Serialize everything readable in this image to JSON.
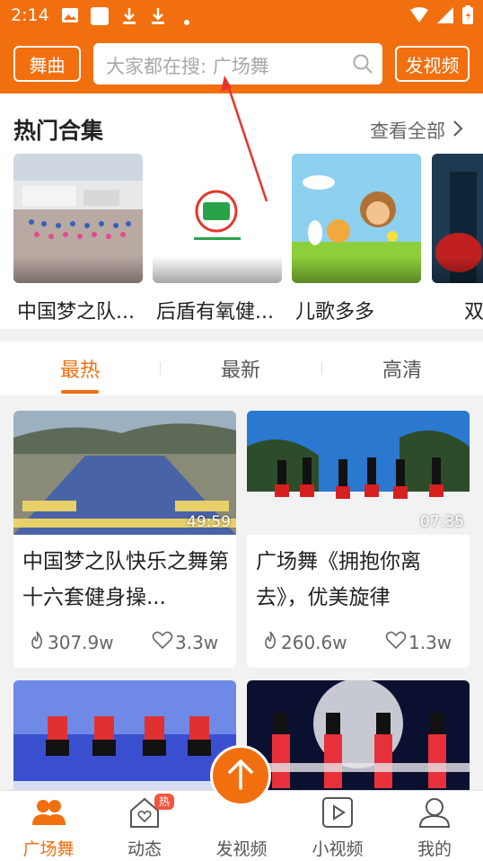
{
  "status_bar": {
    "time": "2:14"
  },
  "header": {
    "left_button": "舞曲",
    "search_placeholder": "大家都在搜: 广场舞",
    "right_button": "发视频"
  },
  "hot_collections": {
    "title": "热门合集",
    "see_all": "查看全部",
    "items": [
      {
        "label": "中国梦之队..."
      },
      {
        "label": "后盾有氧健..."
      },
      {
        "label": "儿歌多多"
      },
      {
        "label": "双"
      }
    ]
  },
  "tabs": [
    {
      "label": "最热",
      "active": true
    },
    {
      "label": "最新",
      "active": false
    },
    {
      "label": "高清",
      "active": false
    }
  ],
  "videos": [
    {
      "title": "中国梦之队快乐之舞第十六套健身操...",
      "duration": "49:59",
      "plays": "307.9w",
      "likes": "3.3w"
    },
    {
      "title": "广场舞《拥抱你离去》，优美旋律",
      "duration": "07:35",
      "plays": "260.6w",
      "likes": "1.3w"
    }
  ],
  "bottom_nav": {
    "items": [
      {
        "label": "广场舞",
        "icon": "users-icon",
        "active": true
      },
      {
        "label": "动态",
        "icon": "home-heart-icon",
        "badge": "热"
      },
      {
        "label": "发视频",
        "icon": "upload-arrow-icon"
      },
      {
        "label": "小视频",
        "icon": "play-square-icon"
      },
      {
        "label": "我的",
        "icon": "person-icon"
      }
    ]
  },
  "colors": {
    "accent": "#f26f10",
    "annotation": "#e8332a"
  }
}
